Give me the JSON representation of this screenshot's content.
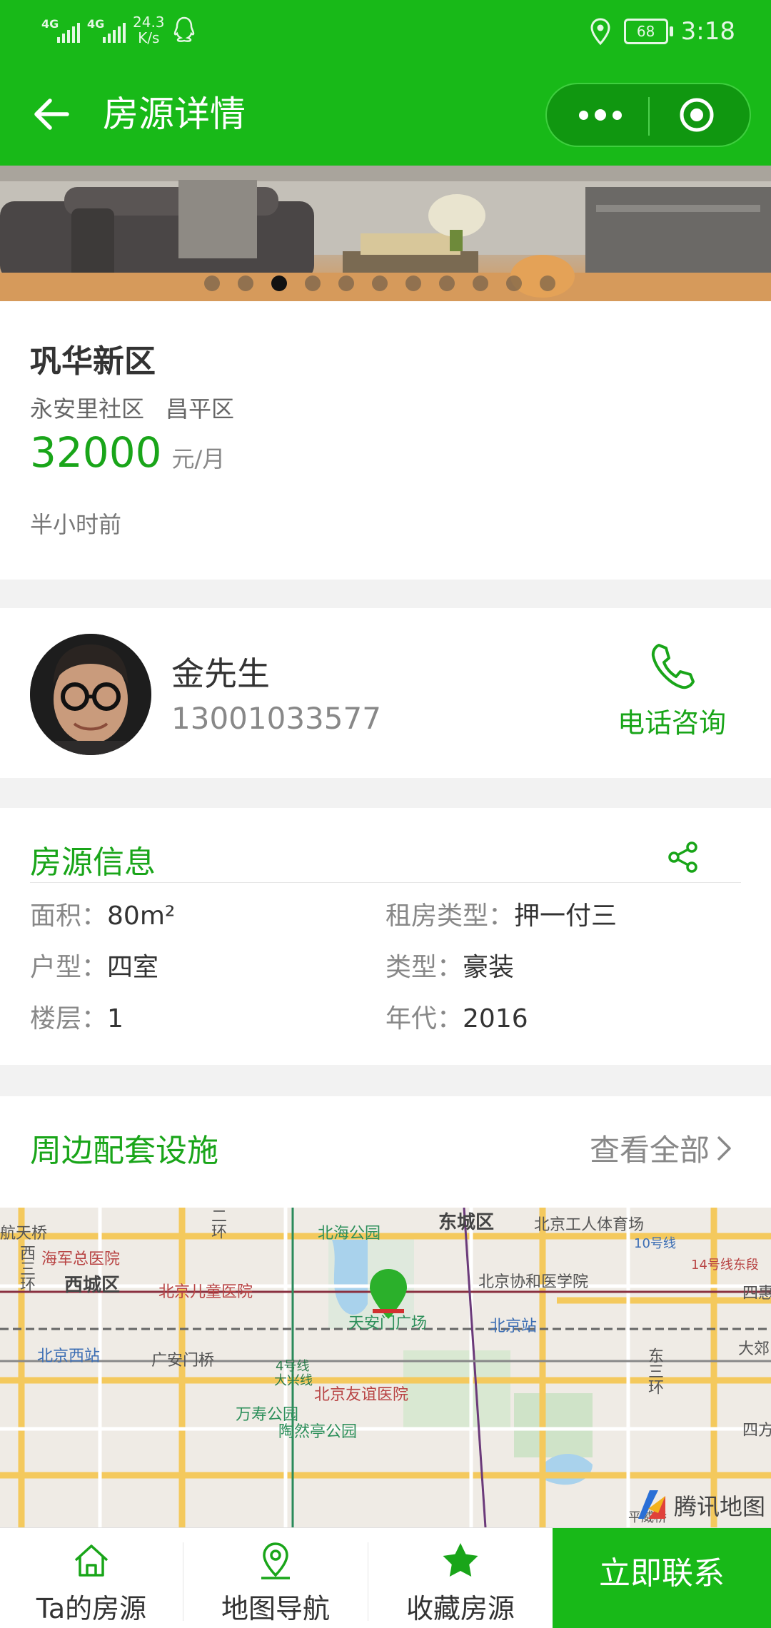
{
  "status_bar": {
    "network_1": "4G",
    "network_2": "4G",
    "speed_value": "24.3",
    "speed_unit": "K/s",
    "battery": "68",
    "time": "3:18"
  },
  "nav": {
    "title": "房源详情"
  },
  "banner": {
    "total_images": 11,
    "active_index": 2
  },
  "house": {
    "name": "巩华新区",
    "community": "永安里社区",
    "district": "昌平区",
    "price": "32000",
    "price_unit": "元/月",
    "posted": "半小时前"
  },
  "agent": {
    "name": "金先生",
    "phone": "13001033577",
    "call_label": "电话咨询"
  },
  "info": {
    "title": "房源信息",
    "area_label": "面积：",
    "area_value": "80m²",
    "rent_type_label": "租房类型：",
    "rent_type_value": "押一付三",
    "layout_label": "户型：",
    "layout_value": "四室",
    "decor_label": "类型：",
    "decor_value": "豪装",
    "floor_label": "楼层：",
    "floor_value": "1",
    "year_label": "年代：",
    "year_value": "2016"
  },
  "facilities": {
    "title": "周边配套设施",
    "see_all": "查看全部"
  },
  "map": {
    "labels": {
      "l1": "航天桥",
      "l2": "西三环",
      "l3": "海军总医院",
      "l4": "西城区",
      "l5": "北京儿童医院",
      "l6": "北海公园",
      "l7": "东城区",
      "l8": "北京工人体育场",
      "l9": "10号线",
      "l10": "14号线东段",
      "l11": "北京协和医学院",
      "l12": "天安门广场",
      "l13": "北京站",
      "l14": "北京西站",
      "l15": "广安门桥",
      "l16": "4号线",
      "l16b": "大兴线",
      "l17": "北京友谊医院",
      "l18": "万寿公园",
      "l19": "陶然亭公园",
      "l20": "东三环",
      "l21": "大郊",
      "l22": "四惠",
      "l23": "四方",
      "l24": "二环",
      "l25": "平威桥"
    },
    "provider": "腾讯地图"
  },
  "tabs": {
    "t1": "Ta的房源",
    "t2": "地图导航",
    "t3": "收藏房源",
    "contact": "立即联系"
  },
  "colors": {
    "brand": "#18b918",
    "accent_text": "#19a519"
  }
}
